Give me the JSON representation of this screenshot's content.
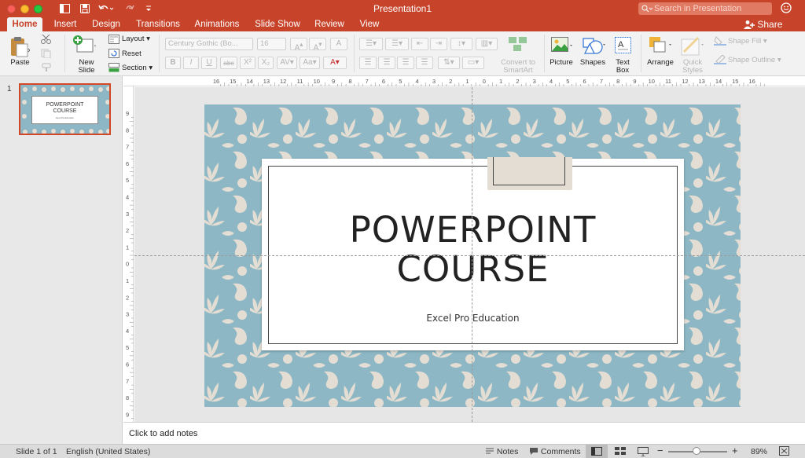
{
  "window": {
    "title": "Presentation1"
  },
  "search": {
    "placeholder": "Search in Presentation"
  },
  "tabs": [
    "Home",
    "Insert",
    "Design",
    "Transitions",
    "Animations",
    "Slide Show",
    "Review",
    "View"
  ],
  "share_label": "Share",
  "ribbon": {
    "paste": "Paste",
    "new_slide": [
      "New",
      "Slide"
    ],
    "layout": "Layout",
    "reset": "Reset",
    "section": "Section",
    "font_name": "Century Gothic (Bo...",
    "font_size": "16",
    "convert_smartart": [
      "Convert to",
      "SmartArt"
    ],
    "picture": "Picture",
    "shapes": "Shapes",
    "text_box": [
      "Text",
      "Box"
    ],
    "arrange": "Arrange",
    "quick_styles": [
      "Quick",
      "Styles"
    ],
    "shape_fill": "Shape Fill",
    "shape_outline": "Shape Outline"
  },
  "slide": {
    "number": "1",
    "title_line1": "POWERPOINT",
    "title_line2": "COURSE",
    "subtitle": "Excel Pro Education",
    "thumb_title_line1": "POWERPOINT",
    "thumb_title_line2": "COURSE",
    "thumb_subtitle": "Excel Pro Education"
  },
  "notes": {
    "placeholder": "Click to add notes"
  },
  "status": {
    "slide_count": "Slide 1 of 1",
    "language": "English (United States)",
    "notes_label": "Notes",
    "comments_label": "Comments",
    "zoom": "89%"
  },
  "ruler": {
    "h_ticks": [
      "16",
      "15",
      "14",
      "13",
      "12",
      "11",
      "10",
      "9",
      "8",
      "7",
      "6",
      "5",
      "4",
      "3",
      "2",
      "1",
      "0",
      "1",
      "2",
      "3",
      "4",
      "5",
      "6",
      "7",
      "8",
      "9",
      "10",
      "11",
      "12",
      "13",
      "14",
      "15",
      "16"
    ],
    "v_ticks": [
      "9",
      "8",
      "7",
      "6",
      "5",
      "4",
      "3",
      "2",
      "1",
      "0",
      "1",
      "2",
      "3",
      "4",
      "5",
      "6",
      "7",
      "8",
      "9"
    ]
  },
  "colors": {
    "accent": "#c7432a",
    "slide_bg": "#8db7c4",
    "pattern": "#e3ddd3",
    "selected_thumb_border": "#d24726"
  },
  "icons": [
    "search-icon",
    "smiley-icon",
    "share-icon",
    "paste-icon",
    "new-slide-icon",
    "picture-icon",
    "shapes-icon",
    "text-box-icon",
    "arrange-icon",
    "quick-styles-icon",
    "notes-icon",
    "comments-icon",
    "normal-view-icon",
    "slide-sorter-icon",
    "reading-view-icon",
    "fit-window-icon"
  ]
}
